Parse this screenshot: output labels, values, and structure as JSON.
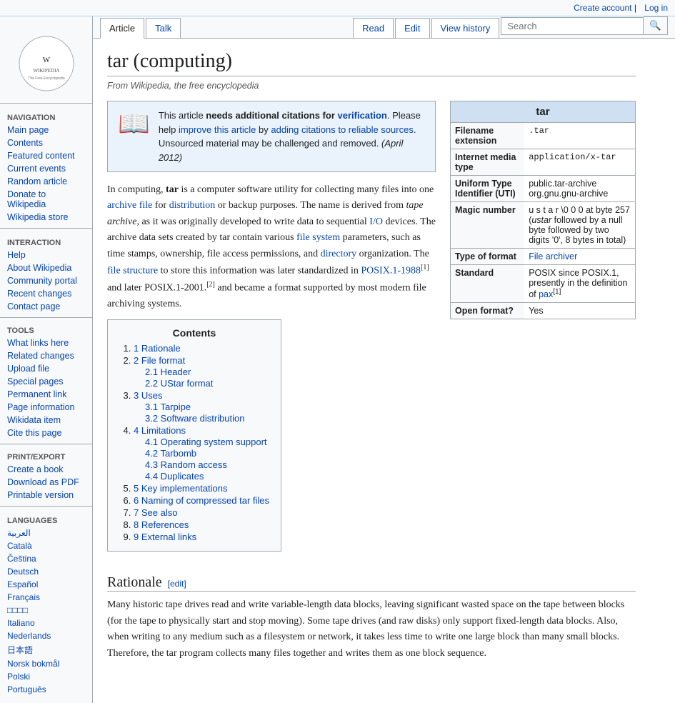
{
  "topbar": {
    "create_account": "Create account",
    "log_in": "Log in"
  },
  "logo": {
    "wiki_name": "Wikipedia",
    "wiki_sub": "The Free Encyclopedia"
  },
  "nav": {
    "navigation_title": "Navigation",
    "items": [
      {
        "label": "Main page",
        "href": "#"
      },
      {
        "label": "Contents",
        "href": "#"
      },
      {
        "label": "Featured content",
        "href": "#"
      },
      {
        "label": "Current events",
        "href": "#"
      },
      {
        "label": "Random article",
        "href": "#"
      },
      {
        "label": "Donate to Wikipedia",
        "href": "#"
      },
      {
        "label": "Wikipedia store",
        "href": "#"
      }
    ],
    "interaction_title": "Interaction",
    "interaction_items": [
      {
        "label": "Help",
        "href": "#"
      },
      {
        "label": "About Wikipedia",
        "href": "#"
      },
      {
        "label": "Community portal",
        "href": "#"
      },
      {
        "label": "Recent changes",
        "href": "#"
      },
      {
        "label": "Contact page",
        "href": "#"
      }
    ],
    "tools_title": "Tools",
    "tools_items": [
      {
        "label": "What links here",
        "href": "#"
      },
      {
        "label": "Related changes",
        "href": "#"
      },
      {
        "label": "Upload file",
        "href": "#"
      },
      {
        "label": "Special pages",
        "href": "#"
      },
      {
        "label": "Permanent link",
        "href": "#"
      },
      {
        "label": "Page information",
        "href": "#"
      },
      {
        "label": "Wikidata item",
        "href": "#"
      },
      {
        "label": "Cite this page",
        "href": "#"
      }
    ],
    "print_title": "Print/export",
    "print_items": [
      {
        "label": "Create a book",
        "href": "#"
      },
      {
        "label": "Download as PDF",
        "href": "#"
      },
      {
        "label": "Printable version",
        "href": "#"
      }
    ],
    "languages_title": "Languages",
    "languages": [
      {
        "label": "العربية",
        "href": "#"
      },
      {
        "label": "Català",
        "href": "#"
      },
      {
        "label": "Čeština",
        "href": "#"
      },
      {
        "label": "Deutsch",
        "href": "#"
      },
      {
        "label": "Español",
        "href": "#"
      },
      {
        "label": "Français",
        "href": "#"
      },
      {
        "label": "日本語",
        "href": "#"
      },
      {
        "label": "Italiano",
        "href": "#"
      },
      {
        "label": "Nederlands",
        "href": "#"
      },
      {
        "label": "日本語",
        "href": "#"
      },
      {
        "label": "Norsk bokmål",
        "href": "#"
      },
      {
        "label": "Polski",
        "href": "#"
      },
      {
        "label": "Português",
        "href": "#"
      }
    ]
  },
  "tabs": {
    "article": "Article",
    "talk": "Talk",
    "read": "Read",
    "edit": "Edit",
    "view_history": "View history",
    "search_placeholder": "Search"
  },
  "page": {
    "title": "tar (computing)",
    "subtitle": "From Wikipedia, the free encyclopedia"
  },
  "notice": {
    "icon": "📖",
    "text_before": "This article ",
    "bold_text": "needs additional citations for",
    "link_text": "verification",
    "text_middle": ". Please help ",
    "link2_text": "improve this article",
    "text_after": " by ",
    "link3_text": "adding citations to reliable sources",
    "text_end": ". Unsourced material may be challenged and removed.",
    "date": "(April 2012)"
  },
  "infobox": {
    "title": "tar",
    "rows": [
      {
        "label": "Filename extension",
        "value": ".tar",
        "is_link": false
      },
      {
        "label": "Internet media type",
        "value": "application/x-tar",
        "is_link": false
      },
      {
        "label": "Uniform Type Identifier (UTI)",
        "value": "public.tar-archive\norg.gnu.gnu-archive",
        "is_link": false
      },
      {
        "label": "Magic number",
        "value": "u s t a r \\0 0 0 at byte 257 (ustar followed by a null byte followed by two digits '0', 8 bytes in total)",
        "is_link": false
      },
      {
        "label": "Type of format",
        "value": "File archiver",
        "is_link": true
      },
      {
        "label": "Standard",
        "value": "POSIX since POSIX.1, presently in the definition of pax[1]",
        "is_link": false
      },
      {
        "label": "Open format?",
        "value": "Yes",
        "is_link": false
      }
    ]
  },
  "article": {
    "intro": "In computing, tar is a computer software utility for collecting many files into one archive file for distribution or backup purposes. The name is derived from tape archive, as it was originally developed to write data to sequential I/O devices. The archive data sets created by tar contain various file system parameters, such as time stamps, ownership, file access permissions, and directory organization. The file structure to store this information was later standardized in POSIX.1-1988[1] and later POSIX.1-2001.[2] and became a format supported by most modern file archiving systems."
  },
  "toc": {
    "title": "Contents",
    "items": [
      {
        "num": "1",
        "label": "Rationale",
        "sub": []
      },
      {
        "num": "2",
        "label": "File format",
        "sub": [
          {
            "num": "2.1",
            "label": "Header"
          },
          {
            "num": "2.2",
            "label": "UStar format"
          }
        ]
      },
      {
        "num": "3",
        "label": "Uses",
        "sub": [
          {
            "num": "3.1",
            "label": "Tarpipe"
          },
          {
            "num": "3.2",
            "label": "Software distribution"
          }
        ]
      },
      {
        "num": "4",
        "label": "Limitations",
        "sub": [
          {
            "num": "4.1",
            "label": "Operating system support"
          },
          {
            "num": "4.2",
            "label": "Tarbomb"
          },
          {
            "num": "4.3",
            "label": "Random access"
          },
          {
            "num": "4.4",
            "label": "Duplicates"
          }
        ]
      },
      {
        "num": "5",
        "label": "Key implementations",
        "sub": []
      },
      {
        "num": "6",
        "label": "Naming of compressed tar files",
        "sub": []
      },
      {
        "num": "7",
        "label": "See also",
        "sub": []
      },
      {
        "num": "8",
        "label": "References",
        "sub": []
      },
      {
        "num": "9",
        "label": "External links",
        "sub": []
      }
    ]
  },
  "rationale": {
    "heading": "Rationale",
    "edit_label": "[edit]",
    "body": "Many historic tape drives read and write variable-length data blocks, leaving significant wasted space on the tape between blocks (for the tape to physically start and stop moving). Some tape drives (and raw disks) only support fixed-length data blocks. Also, when writing to any medium such as a filesystem or network, it takes less time to write one large block than many small blocks. Therefore, the tar program collects many files together and writes them as one block sequence."
  },
  "colors": {
    "accent": "#0645ad",
    "border": "#a2a9b1",
    "bg_light": "#f8f9fa",
    "notice_bg": "#eaf3fb",
    "infobox_header": "#cee0f2",
    "toc_bg": "#f8f9fa"
  }
}
